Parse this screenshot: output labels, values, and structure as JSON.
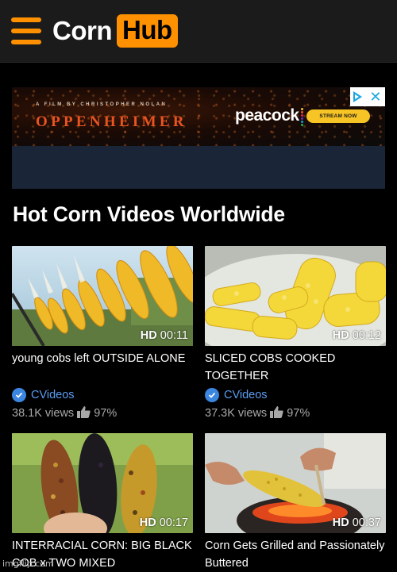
{
  "header": {
    "logo_left": "Corn",
    "logo_right": "Hub",
    "brand_color": "#ff9000"
  },
  "ad": {
    "credit": "A FILM BY CHRISTOPHER NOLAN",
    "title": "OPPENHEIMER",
    "brand": "peacock",
    "cta": "STREAM NOW"
  },
  "section": {
    "title": "Hot Corn Videos Worldwide"
  },
  "videos": [
    {
      "quality": "HD",
      "duration": "00:11",
      "title": "young cobs left OUTSIDE ALONE",
      "channel": "CVideos",
      "views": "38.1K views",
      "rating": "97%"
    },
    {
      "quality": "HD",
      "duration": "00:12",
      "title": "SLICED COBS COOKED TOGETHER",
      "channel": "CVideos",
      "views": "37.3K views",
      "rating": "97%"
    },
    {
      "quality": "HD",
      "duration": "00:17",
      "title": "INTERRACIAL CORN: BIG BLACK COB x TWO MIXED"
    },
    {
      "quality": "HD",
      "duration": "00:37",
      "title": "Corn Gets Grilled and Passionately Buttered"
    }
  ],
  "watermark": "imgflip.com"
}
